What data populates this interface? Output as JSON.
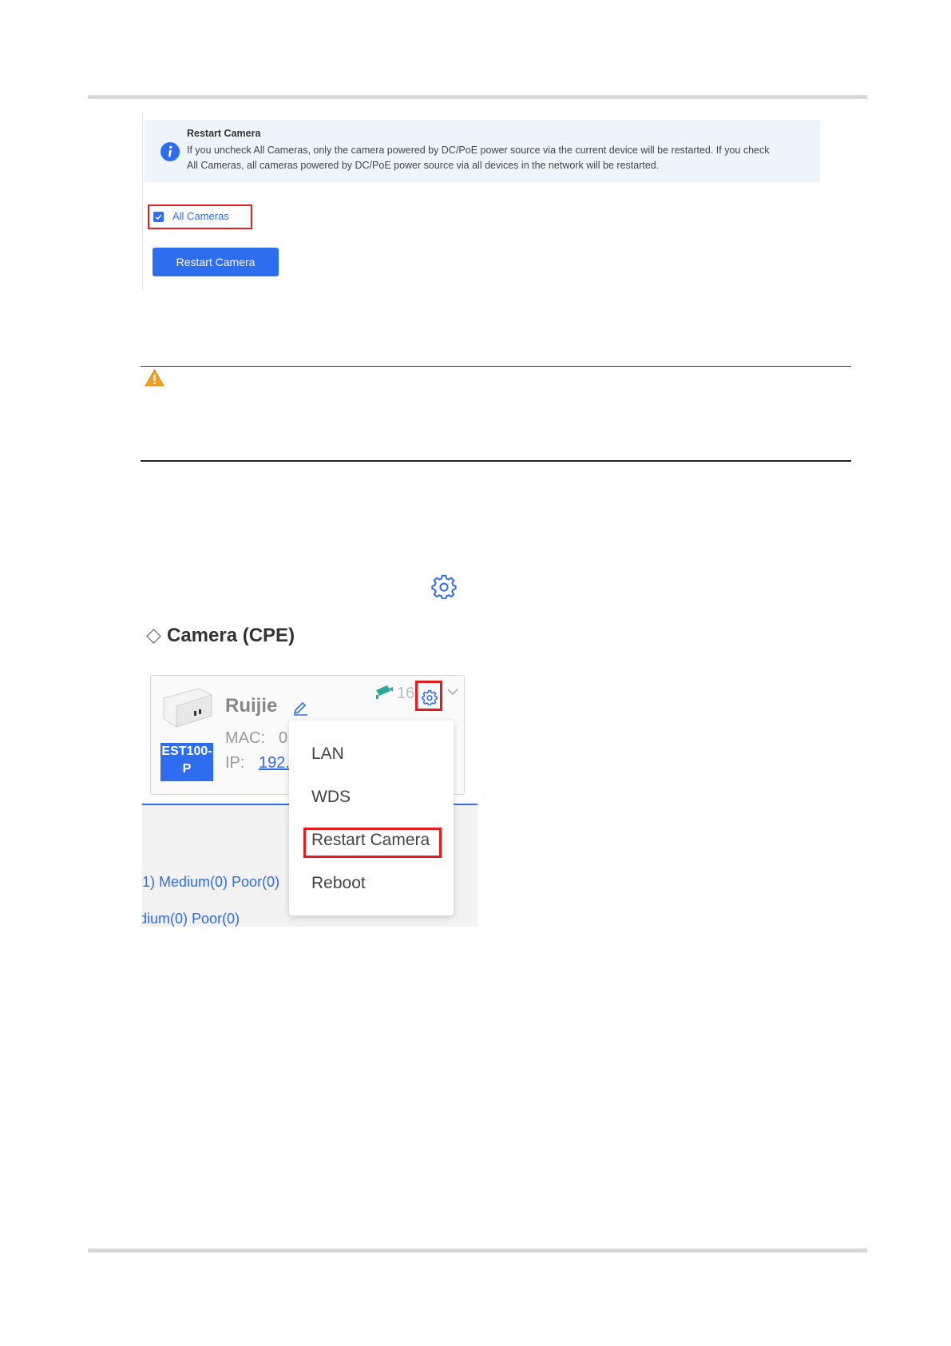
{
  "top_panel": {
    "notice_title": "Restart Camera",
    "notice_line1": "If you uncheck All Cameras, only the camera powered by DC/PoE power source via the current device will be restarted. If you check",
    "notice_line2": "All Cameras, all cameras powered by DC/PoE power source via all devices in the network will be restarted.",
    "checkbox_label": "All Cameras",
    "checkbox_checked": true,
    "button_label": "Restart Camera"
  },
  "camera_panel": {
    "section_title": "Camera (CPE)",
    "device_name": "Ruijie",
    "model": "EST100-P",
    "mac_label": "MAC:",
    "mac_value": "0",
    "ip_label": "IP:",
    "ip_value": "192.",
    "camera_count": "16",
    "menu_items": [
      "LAN",
      "WDS",
      "Restart Camera",
      "Reboot"
    ],
    "signal_row_1": "1)  Medium(0)   Poor(0)",
    "signal_row_2": "dium(0)   Poor(0)"
  },
  "icons": {
    "info": "info-icon",
    "warning": "warning-icon",
    "gear": "gear-icon",
    "camera": "camera-icon",
    "edit": "edit-icon",
    "chevron": "chevron-down-icon"
  },
  "colors": {
    "accent": "#2f6df0",
    "highlight": "#e11d1d",
    "warning": "#f0a020",
    "notice_bg": "#edf4fc"
  }
}
